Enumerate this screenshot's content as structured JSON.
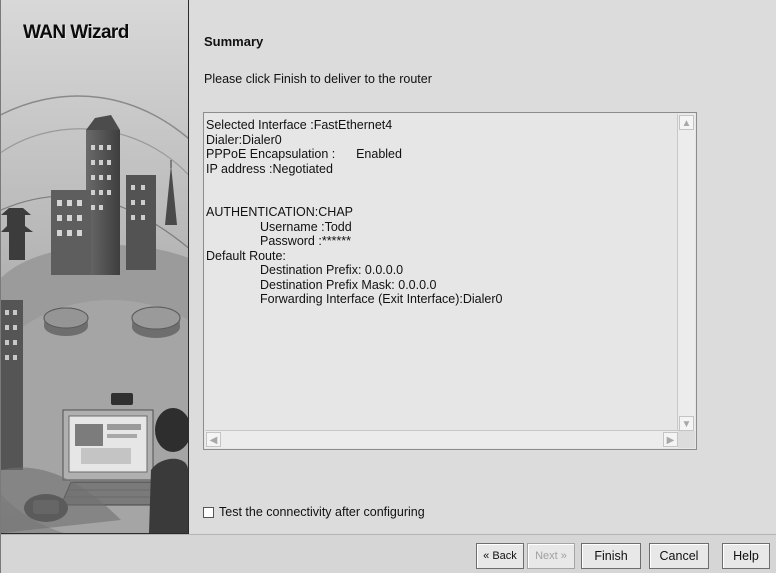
{
  "wizard": {
    "title": "WAN Wizard"
  },
  "page": {
    "heading": "Summary",
    "instruction": "Please click Finish to deliver to the router"
  },
  "summary": {
    "lines": [
      "Selected Interface :FastEthernet4",
      "Dialer:Dialer0",
      "PPPoE Encapsulation :      Enabled",
      "IP address :Negotiated",
      "",
      "",
      "AUTHENTICATION:CHAP",
      "Username :Todd",
      "Password :******",
      "Default Route:",
      "Destination Prefix: 0.0.0.0",
      "Destination Prefix Mask: 0.0.0.0",
      "Forwarding Interface (Exit Interface):Dialer0"
    ]
  },
  "options": {
    "test_connectivity_label": "Test the connectivity after configuring",
    "test_connectivity_checked": false
  },
  "buttons": {
    "back": "« Back",
    "next": "Next »",
    "finish": "Finish",
    "cancel": "Cancel",
    "help": "Help"
  },
  "icons": {
    "scroll_up": "chevron-up-icon",
    "scroll_down": "chevron-down-icon",
    "scroll_left": "chevron-left-icon",
    "scroll_right": "chevron-right-icon"
  }
}
